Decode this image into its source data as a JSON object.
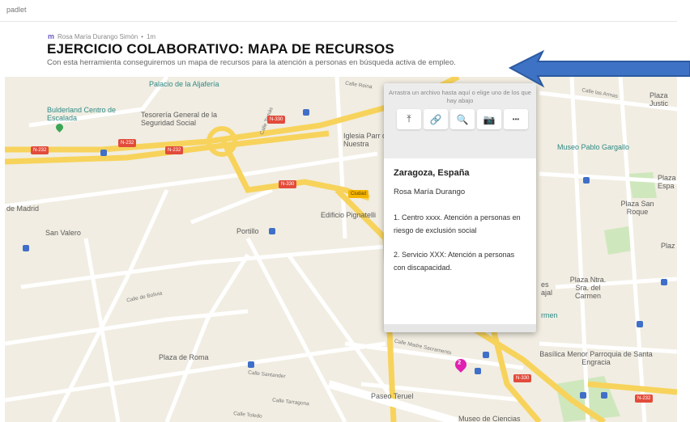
{
  "app": {
    "brand": "padlet"
  },
  "post": {
    "author_initial": "m",
    "author": "Rosa María Durango Simón",
    "separator": "•",
    "age": "1m",
    "title": "EJERCICIO COLABORATIVO: MAPA DE RECURSOS",
    "description": "Con esta herramienta conseguiremos un mapa de recursos para la atención a personas en búsqueda activa de empleo."
  },
  "popup": {
    "upload_hint": "Arrastra un archivo hasta aquí o elige uno de los que hay abajo",
    "tools": [
      {
        "icon": "upload-icon",
        "glyph": "⤒"
      },
      {
        "icon": "link-icon",
        "glyph": "🔗"
      },
      {
        "icon": "search-icon",
        "glyph": "🔍"
      },
      {
        "icon": "camera-icon",
        "glyph": "📷"
      },
      {
        "icon": "more-icon",
        "glyph": "•••"
      }
    ],
    "location": "Zaragoza, España",
    "author": "Rosa María Durango",
    "item1": "1. Centro xxxx. Atención a personas en riesgo de exclusión social",
    "item2": "2. Servicio XXX: Atención a personas con discapacidad."
  },
  "pin": {
    "label": "2",
    "color": "#e020b0"
  },
  "map": {
    "labels": {
      "aljaferia": "Palacio de la Aljafería",
      "bulderland": "Bulderland Centro de Escalada",
      "tesoreria": "Tesorería General de la Seguridad Social",
      "iglesia": "Iglesia Parr de Nuestra",
      "madrid": "de Madrid",
      "valero": "San Valero",
      "portillo": "Portillo",
      "pignatelli": "Edificio Pignatelli",
      "roma": "Plaza de Roma",
      "paseo_teruel": "Paseo Teruel",
      "museo_ciencias": "Museo de Ciencias",
      "museo_gargallo": "Museo Pablo Gargallo",
      "espana": "Plaza Espa",
      "san_roque": "Plaza San Roque",
      "plaz": "Plaz",
      "plaza_ntra": "Plaza Ntra. Sra. del Carmen",
      "es_ajal": "es ajal",
      "armen": "rmen",
      "basilica": "Basílica Menor Parroquia de Santa Engracia",
      "plaza_justi": "Plaza Justic",
      "ciudad": "Ciudad"
    },
    "streets": {
      "armas": "Calle las Armas",
      "reina": "Calle Reina",
      "tomas": "Calle Tomás",
      "sacramento": "Calle Madre Sacramento",
      "santander": "Calle Santander",
      "tarragona": "Calle Tarragona",
      "toledo": "Calle Toledo",
      "bolivia": "Calle de Bolivia"
    },
    "badges": {
      "n232a": "N-232",
      "n232b": "N-232",
      "n232c": "N-232",
      "n330a": "N-330",
      "n330b": "N-330",
      "n330c": "N-330",
      "n232d": "N-232"
    }
  },
  "colors": {
    "map_bg": "#f1ede2",
    "road_major": "#f7d35c",
    "road_minor": "#ffffff",
    "park": "#cfe7bd",
    "arrow": "#3d72c4"
  }
}
